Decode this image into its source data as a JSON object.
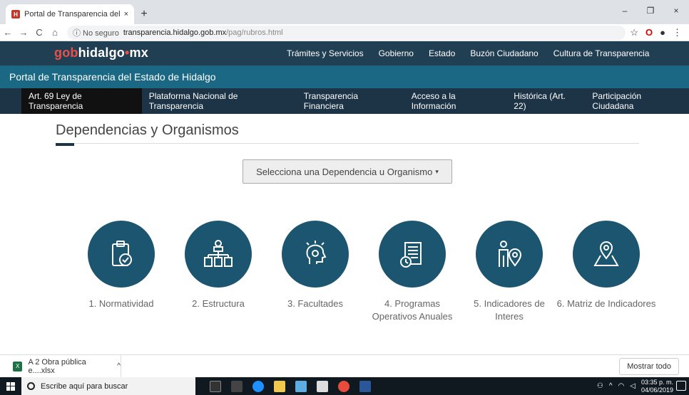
{
  "browser": {
    "tab_title": "Portal de Transparencia del Estad",
    "new_tab": "+",
    "tab_close": "×",
    "win_min": "–",
    "win_max": "❐",
    "win_close": "×",
    "nav_back": "←",
    "nav_forward": "→",
    "nav_reload": "C",
    "nav_home": "⌂",
    "security_label": "ⓘ No seguro",
    "url_host": "transparencia.hidalgo.gob.mx",
    "url_path": "/pag/rubros.html",
    "star": "☆",
    "opera": "O",
    "account": "●",
    "menu": "⋮"
  },
  "header": {
    "logo_gob": "gob",
    "logo_hidalgo": "hidalgo",
    "logo_dot": "•",
    "logo_mx": "mx",
    "top_links": [
      "Trámites y Servicios",
      "Gobierno",
      "Estado",
      "Buzón Ciudadano",
      "Cultura de Transparencia"
    ],
    "portal_title": "Portal de Transparencia del Estado de Hidalgo",
    "sec_links": [
      "Art. 69 Ley de Transparencia",
      "Plataforma Nacional de Transparencia",
      "Transparencia Financiera",
      "Acceso a la Información",
      "Histórica (Art. 22)",
      "Participación Ciudadana"
    ]
  },
  "main": {
    "title": "Dependencias y Organismos",
    "dropdown_label": "Selecciona una Dependencia u Organismo",
    "dropdown_caret": "▾",
    "cards": [
      {
        "label": "1. Normatividad",
        "icon": "clipboard-check-icon"
      },
      {
        "label": "2. Estructura",
        "icon": "org-chart-icon"
      },
      {
        "label": "3. Facultades",
        "icon": "head-idea-icon"
      },
      {
        "label": "4. Programas Operativos Anuales",
        "icon": "document-clock-icon"
      },
      {
        "label": "5. Indicadores de Interes",
        "icon": "person-pin-icon"
      },
      {
        "label": "6. Matriz de Indicadores",
        "icon": "map-pin-icon"
      }
    ]
  },
  "downloads": {
    "file": "A 2 Obra pública e....xlsx",
    "chevron": "^",
    "show_all": "Mostrar todo",
    "close": "×"
  },
  "taskbar": {
    "search_placeholder": "Escribe aquí para buscar",
    "time": "03:35 p. m.",
    "date": "04/06/2019"
  },
  "colors": {
    "topnav": "#213f53",
    "portalbar": "#1a6884",
    "circle": "#1c5570"
  }
}
